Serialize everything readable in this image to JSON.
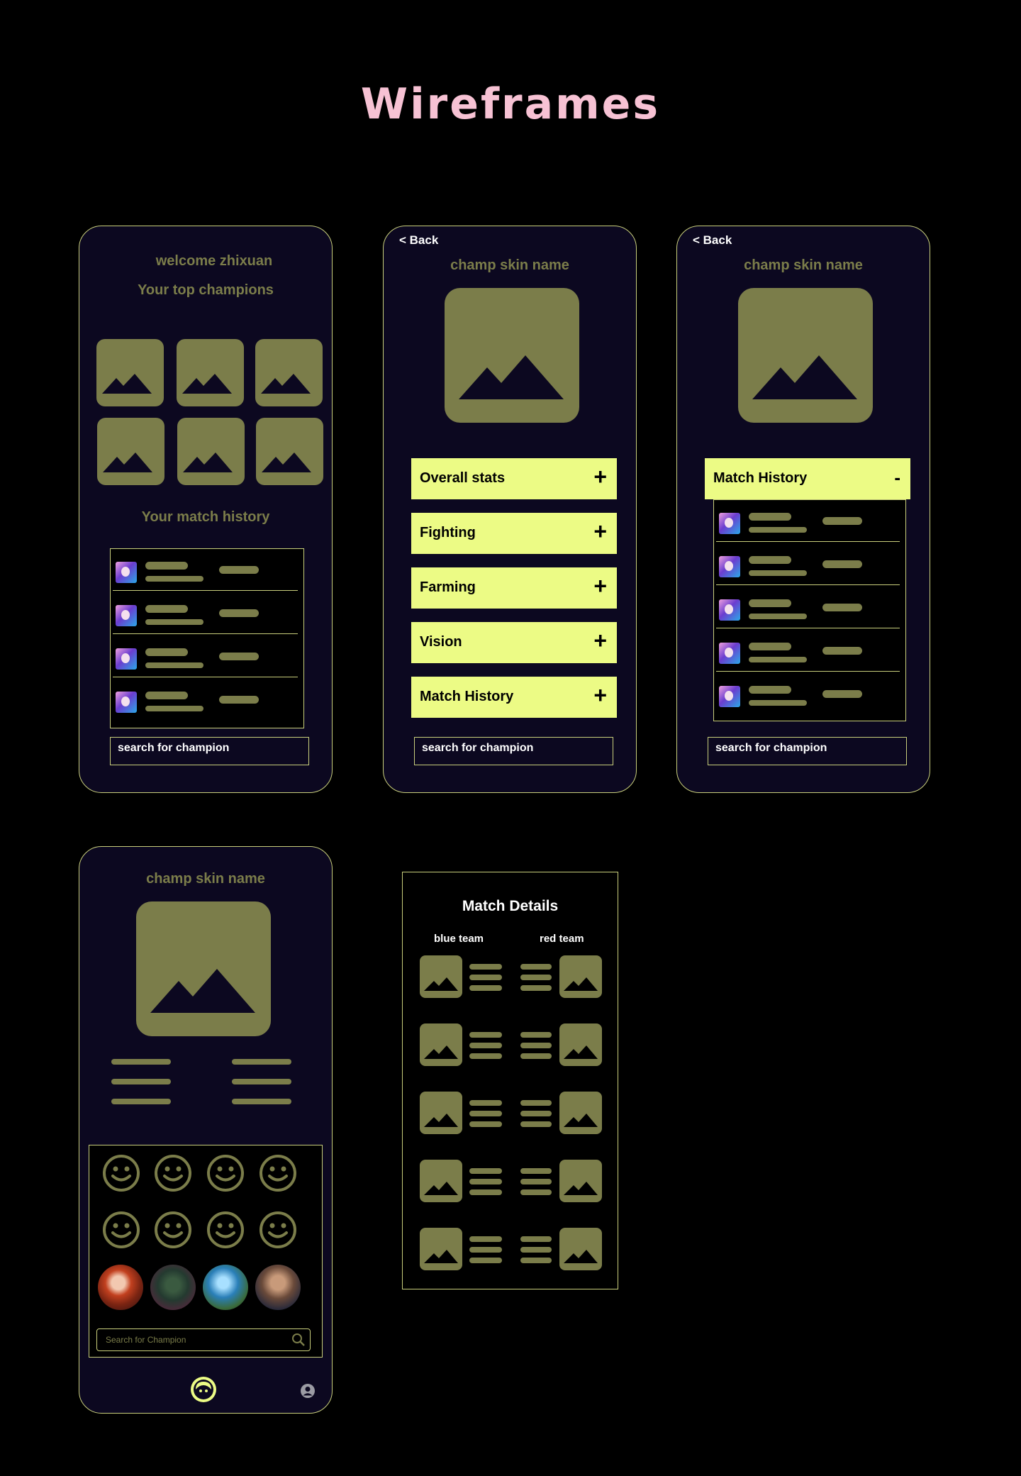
{
  "page_title": "Wireframes",
  "screen1": {
    "welcome": "welcome zhixuan",
    "top_champions": "Your top champions",
    "match_history": "Your match history",
    "search": "search for champion"
  },
  "screen2": {
    "back": "< Back",
    "name": "champ skin name",
    "sections": [
      "Overall stats",
      "Fighting",
      "Farming",
      "Vision",
      "Match History"
    ],
    "expand_sign": "+",
    "search": "search for champion"
  },
  "screen3": {
    "back": "< Back",
    "name": "champ skin name",
    "section": "Match History",
    "collapse_sign": "-",
    "search": "search for champion"
  },
  "screen4": {
    "name": "champ skin name",
    "search_placeholder": "Search for Champion"
  },
  "match_details": {
    "title": "Match Details",
    "blue_team": "blue team",
    "red_team": "red team"
  },
  "colors": {
    "background": "#000000",
    "phone_bg": "#0c0820",
    "accent": "#ecfb85",
    "placeholder": "#7b7d4a",
    "title": "#f7c2d4",
    "border": "#c9cf7c"
  },
  "icons": [
    "image-placeholder-icon",
    "plus-icon",
    "minus-icon",
    "smiley-icon",
    "search-icon",
    "champion-nav-icon",
    "user-icon"
  ]
}
